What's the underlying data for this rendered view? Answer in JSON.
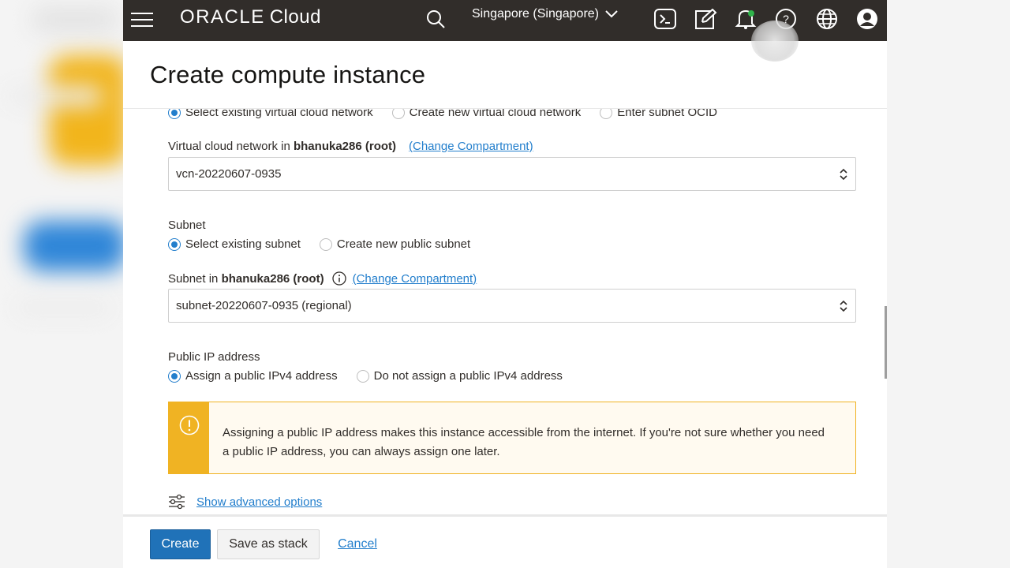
{
  "header": {
    "brand_oracle": "ORACLE",
    "brand_cloud": "Cloud",
    "region_label": "Singapore (Singapore)",
    "icons": [
      "menu-icon",
      "search-icon",
      "chevron-down-icon",
      "cloud-shell-icon",
      "edit-icon",
      "bell-icon",
      "help-icon",
      "globe-icon",
      "user-icon"
    ],
    "notification_dot_color": "#2fb34a"
  },
  "page": {
    "title": "Create compute instance"
  },
  "vcn": {
    "options": [
      {
        "label": "Select existing virtual cloud network",
        "selected": true
      },
      {
        "label": "Create new virtual cloud network",
        "selected": false
      },
      {
        "label": "Enter subnet OCID",
        "selected": false
      }
    ],
    "field_label_prefix": "Virtual cloud network in ",
    "compartment": "bhanuka286 (root)",
    "change_link": "(Change Compartment)",
    "value": "vcn-20220607-0935"
  },
  "subnet": {
    "heading": "Subnet",
    "options": [
      {
        "label": "Select existing subnet",
        "selected": true
      },
      {
        "label": "Create new public subnet",
        "selected": false
      }
    ],
    "field_label_prefix": "Subnet in ",
    "compartment": "bhanuka286 (root)",
    "change_link": "(Change Compartment)",
    "value": "subnet-20220607-0935 (regional)"
  },
  "public_ip": {
    "heading": "Public IP address",
    "options": [
      {
        "label": "Assign a public IPv4 address",
        "selected": true
      },
      {
        "label": "Do not assign a public IPv4 address",
        "selected": false
      }
    ],
    "warning": "Assigning a public IP address makes this instance accessible from the internet. If you're not sure whether you need a public IP address, you can always assign one later."
  },
  "advanced": {
    "label": "Show advanced options"
  },
  "footer": {
    "create": "Create",
    "save_stack": "Save as stack",
    "cancel": "Cancel"
  },
  "colors": {
    "topbar": "#312d2a",
    "accent": "#227ecc",
    "primary_button": "#2072b8",
    "warning": "#f0b323"
  }
}
